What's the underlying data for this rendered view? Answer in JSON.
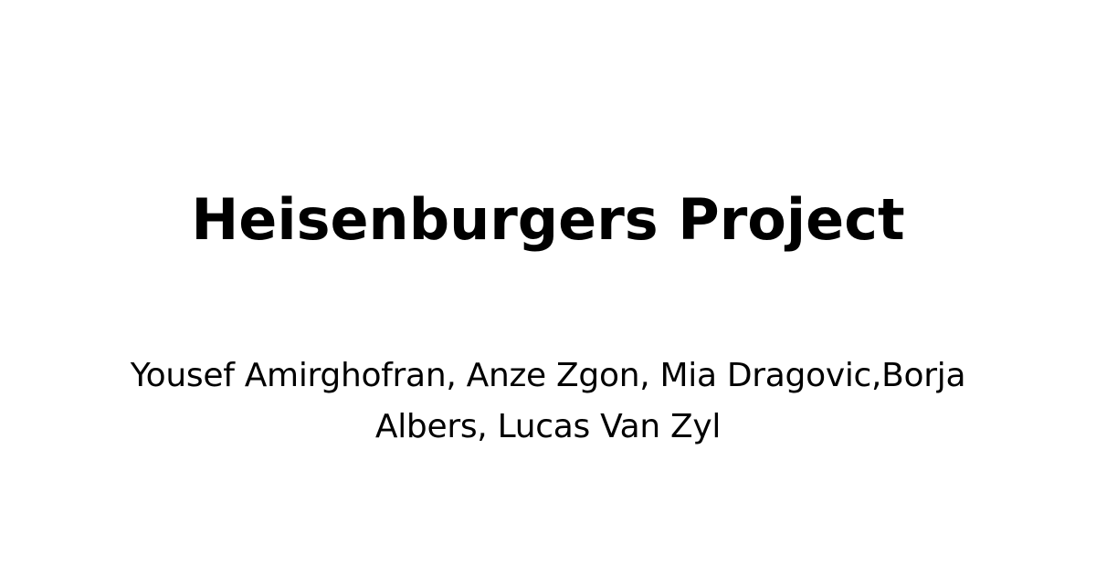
{
  "title": "Heisenburgers Project",
  "authors": {
    "line1": "Yousef Amirghofran, Anze Zgon, Mia Dragovic,Borja",
    "line2": "Albers, Lucas Van Zyl"
  },
  "colors": {
    "background": "#ffffff",
    "text": "#000000"
  }
}
